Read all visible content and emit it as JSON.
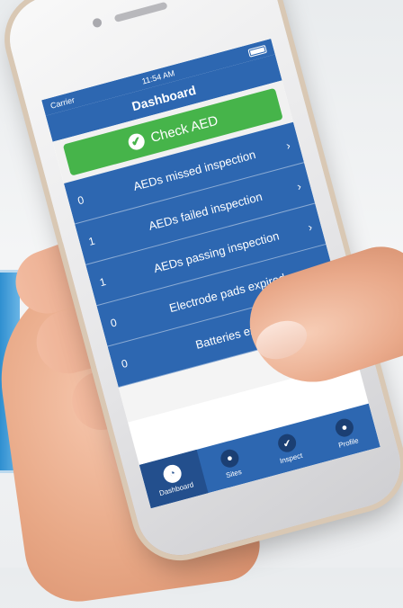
{
  "status_bar": {
    "carrier": "Carrier",
    "time": "11:54 AM"
  },
  "nav": {
    "title": "Dashboard"
  },
  "check_button": {
    "label": "Check AED"
  },
  "rows": [
    {
      "count": "0",
      "label": "AEDs missed inspection"
    },
    {
      "count": "1",
      "label": "AEDs failed inspection"
    },
    {
      "count": "1",
      "label": "AEDs passing inspection"
    },
    {
      "count": "0",
      "label": "Electrode pads expired"
    },
    {
      "count": "0",
      "label": "Batteries expired"
    }
  ],
  "tabs": [
    {
      "label": "Dashboard",
      "icon": "dashboard-icon",
      "active": true
    },
    {
      "label": "Sites",
      "icon": "map-pin-icon",
      "active": false
    },
    {
      "label": "Inspect",
      "icon": "check-icon",
      "active": false
    },
    {
      "label": "Profile",
      "icon": "person-icon",
      "active": false
    }
  ],
  "colors": {
    "header_blue": "#2d67b1",
    "check_green": "#46b44a"
  }
}
